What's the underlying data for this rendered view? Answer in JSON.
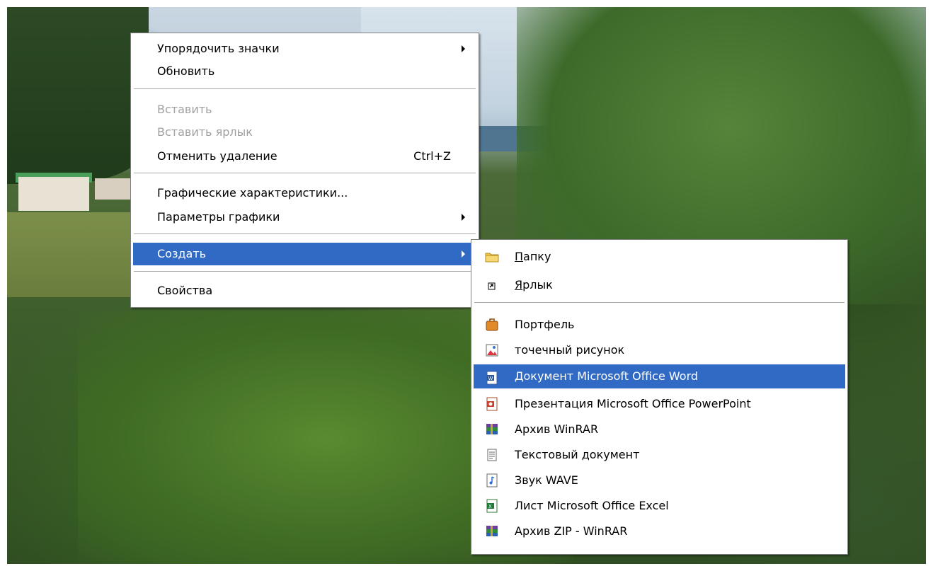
{
  "main_menu": {
    "items": [
      {
        "label": "Упорядочить значки",
        "has_submenu": true,
        "disabled": false
      },
      {
        "label": "Обновить",
        "has_submenu": false,
        "disabled": false
      },
      {
        "label": "Вставить",
        "has_submenu": false,
        "disabled": true
      },
      {
        "label": "Вставить ярлык",
        "has_submenu": false,
        "disabled": true
      },
      {
        "label": "Отменить удаление",
        "shortcut": "Ctrl+Z",
        "has_submenu": false,
        "disabled": false
      },
      {
        "label": "Графические характеристики...",
        "has_submenu": false,
        "disabled": false
      },
      {
        "label": "Параметры графики",
        "has_submenu": true,
        "disabled": false
      },
      {
        "label": "Создать",
        "has_submenu": true,
        "disabled": false,
        "highlighted": true
      },
      {
        "label": "Свойства",
        "has_submenu": false,
        "disabled": false
      }
    ]
  },
  "create_submenu": {
    "items": [
      {
        "label_underlined": "П",
        "label_rest": "апку",
        "icon": "folder-icon"
      },
      {
        "label_underlined": "Я",
        "label_rest": "рлык",
        "icon": "shortcut-icon"
      },
      {
        "label": "Портфель",
        "icon": "briefcase-icon"
      },
      {
        "label": "точечный рисунок",
        "icon": "bitmap-icon"
      },
      {
        "label": "Документ Microsoft Office Word",
        "icon": "word-document-icon",
        "highlighted": true
      },
      {
        "label": "Презентация Microsoft Office PowerPoint",
        "icon": "powerpoint-icon"
      },
      {
        "label": "Архив WinRAR",
        "icon": "winrar-icon"
      },
      {
        "label": "Текстовый документ",
        "icon": "text-document-icon"
      },
      {
        "label": "Звук WAVE",
        "icon": "wave-sound-icon"
      },
      {
        "label": "Лист Microsoft Office Excel",
        "icon": "excel-icon"
      },
      {
        "label": "Архив ZIP - WinRAR",
        "icon": "winrar-zip-icon"
      }
    ]
  },
  "colors": {
    "highlight": "#316ac5",
    "disabled_text": "#a0a0a0",
    "menu_border": "#808080"
  }
}
